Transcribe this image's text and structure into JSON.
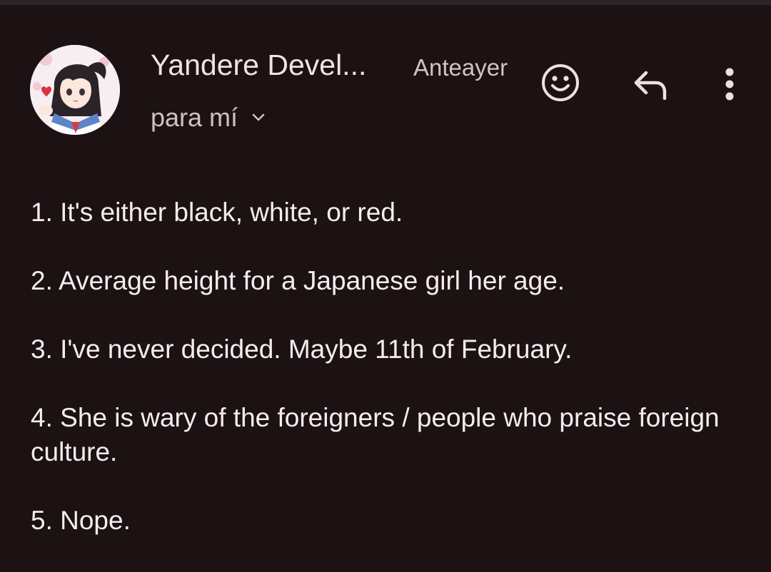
{
  "email": {
    "sender_name": "Yandere Devel...",
    "date": "Anteayer",
    "recipient_label": "para mí",
    "body": [
      "1. It's either black, white, or red.",
      "2. Average height for a Japanese girl her age.",
      "3. I've never decided. Maybe 11th of February.",
      "4. She is wary of the foreigners / people who praise foreign culture.",
      "5. Nope."
    ]
  },
  "icons": {
    "avatar": "anime-girl-avatar",
    "emoji": "smiley-face-icon",
    "reply": "reply-arrow-icon",
    "more": "more-vertical-icon",
    "chevron": "chevron-down-icon"
  },
  "colors": {
    "background": "#1c1214",
    "text": "#f7eced",
    "muted_text": "#d0c0c3",
    "icon": "#f0dfe1"
  }
}
